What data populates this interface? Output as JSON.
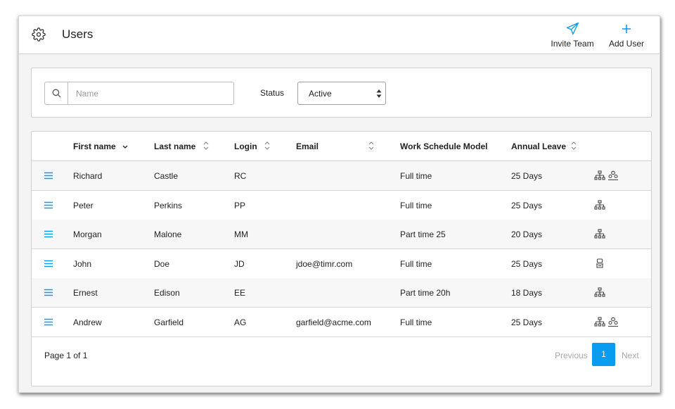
{
  "header": {
    "title": "Users",
    "settings_icon": "gear-icon",
    "actions": [
      {
        "label": "Invite Team",
        "icon": "paper-plane-icon"
      },
      {
        "label": "Add User",
        "icon": "plus-icon"
      }
    ],
    "accent_color": "#0a9cf0"
  },
  "filters": {
    "search_placeholder": "Name",
    "search_value": "",
    "status_label": "Status",
    "status_value": "Active"
  },
  "table": {
    "columns": [
      {
        "label": "First name",
        "sort": "desc"
      },
      {
        "label": "Last name",
        "sort": "both"
      },
      {
        "label": "Login",
        "sort": "both"
      },
      {
        "label": "Email",
        "sort": "both"
      },
      {
        "label": "Work Schedule Model",
        "sort": "none"
      },
      {
        "label": "Annual Leave",
        "sort": "both"
      }
    ],
    "rows": [
      {
        "first": "Richard",
        "last": "Castle",
        "login": "RC",
        "email": "",
        "schedule": "Full time",
        "leave": "25 Days",
        "icons": [
          "org-chart-icon",
          "users-group-icon"
        ]
      },
      {
        "first": "Peter",
        "last": "Perkins",
        "login": "PP",
        "email": "",
        "schedule": "Full time",
        "leave": "25 Days",
        "icons": [
          "org-chart-icon"
        ]
      },
      {
        "first": "Morgan",
        "last": "Malone",
        "login": "MM",
        "email": "",
        "schedule": "Part time 25",
        "leave": "20 Days",
        "icons": [
          "org-chart-icon"
        ]
      },
      {
        "first": "John",
        "last": "Doe",
        "login": "JD",
        "email": "jdoe@timr.com",
        "schedule": "Full time",
        "leave": "25 Days",
        "icons": [
          "user-badge-icon"
        ]
      },
      {
        "first": "Ernest",
        "last": "Edison",
        "login": "EE",
        "email": "",
        "schedule": "Part time 20h",
        "leave": "18 Days",
        "icons": [
          "org-chart-icon"
        ]
      },
      {
        "first": "Andrew",
        "last": "Garfield",
        "login": "AG",
        "email": "garfield@acme.com",
        "schedule": "Full time",
        "leave": "25 Days",
        "icons": [
          "org-chart-icon",
          "users-group-icon"
        ]
      }
    ]
  },
  "pagination": {
    "summary": "Page 1 of 1",
    "previous": "Previous",
    "current": "1",
    "next": "Next"
  }
}
